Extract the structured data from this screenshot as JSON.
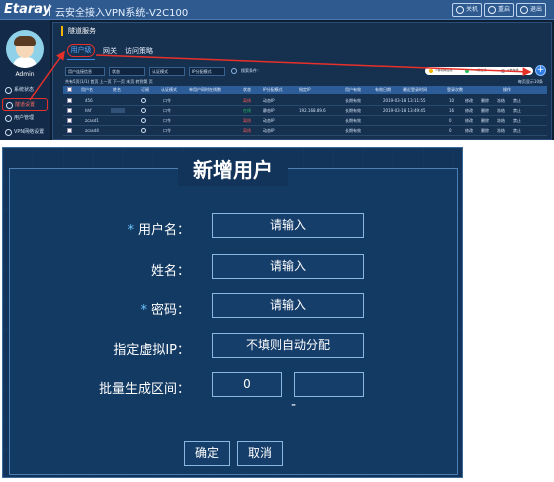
{
  "topbar": {
    "brand": "Etaray",
    "title": "云安全接入VPN系统-V2C100",
    "btn1": "关机",
    "btn2": "重启",
    "btn3": "退出"
  },
  "sidebar": {
    "admin": "Admin",
    "items": [
      "系统状态",
      "隧道设置",
      "用户管理",
      "VPN网络设置"
    ]
  },
  "panel": {
    "section_title": "隧道服务",
    "tabs": [
      "用户级",
      "网关",
      "访问策略"
    ],
    "filters": [
      "用户连接信息",
      "状态",
      "认证模式",
      "IP分配模式"
    ],
    "search_label": "搜索条件：",
    "pager": "共有5页(1/1) 首页 上一页 下一页 末页 转到第 页",
    "perpage": "每页显示10条",
    "legend": [
      "=移动端在线",
      "=PC端在线",
      "=未在线"
    ],
    "add": "+"
  },
  "table": {
    "headers": [
      "用户名",
      "姓名",
      "订阅",
      "认证模式",
      "单用户同时在线数",
      "状态",
      "IP分配模式",
      "指定IP",
      "用户有效",
      "有效日期",
      "最近登录时间",
      "登录次数",
      "操作"
    ],
    "rows": [
      {
        "name": "456",
        "auth": "口令",
        "status": "离线",
        "status_class": "off",
        "ipmode": "动态IP",
        "ip": "",
        "valid": "长期有效",
        "date": "2019-03-18 13:11:55",
        "count": "10",
        "ops": [
          "修改",
          "删除",
          "冻结",
          "禁止"
        ]
      },
      {
        "name": "hhf",
        "auth": "口令",
        "status": "在线",
        "status_class": "on",
        "ipmode": "静态IP",
        "ip": "192.168.89.6",
        "valid": "长期有效",
        "date": "2019-03-18 13:49:45",
        "count": "16",
        "ops": [
          "修改",
          "删除",
          "冻结",
          "禁止"
        ]
      },
      {
        "name": "zcasd1",
        "auth": "口令",
        "status": "离线",
        "status_class": "off",
        "ipmode": "动态IP",
        "ip": "",
        "valid": "长期有效",
        "date": "",
        "count": "0",
        "ops": [
          "修改",
          "删除",
          "冻结",
          "禁止"
        ]
      },
      {
        "name": "zcasd4",
        "auth": "口令",
        "status": "离线",
        "status_class": "off",
        "ipmode": "动态IP",
        "ip": "",
        "valid": "长期有效",
        "date": "",
        "count": "0",
        "ops": [
          "修改",
          "删除",
          "冻结",
          "禁止"
        ]
      }
    ]
  },
  "dialog": {
    "title": "新增用户",
    "username_label": "用户名：",
    "username_placeholder": "请输入",
    "realname_label": "姓名：",
    "realname_placeholder": "请输入",
    "password_label": "密码：",
    "password_placeholder": "请输入",
    "vip_label": "指定虚拟IP：",
    "vip_placeholder": "不填则自动分配",
    "range_label": "批量生成区间：",
    "range_start": "0",
    "range_sep": "-",
    "range_end": "",
    "confirm": "确定",
    "cancel": "取消"
  },
  "colors": {
    "annotation_red": "#e8302a",
    "accent_blue": "#2f7de1"
  }
}
